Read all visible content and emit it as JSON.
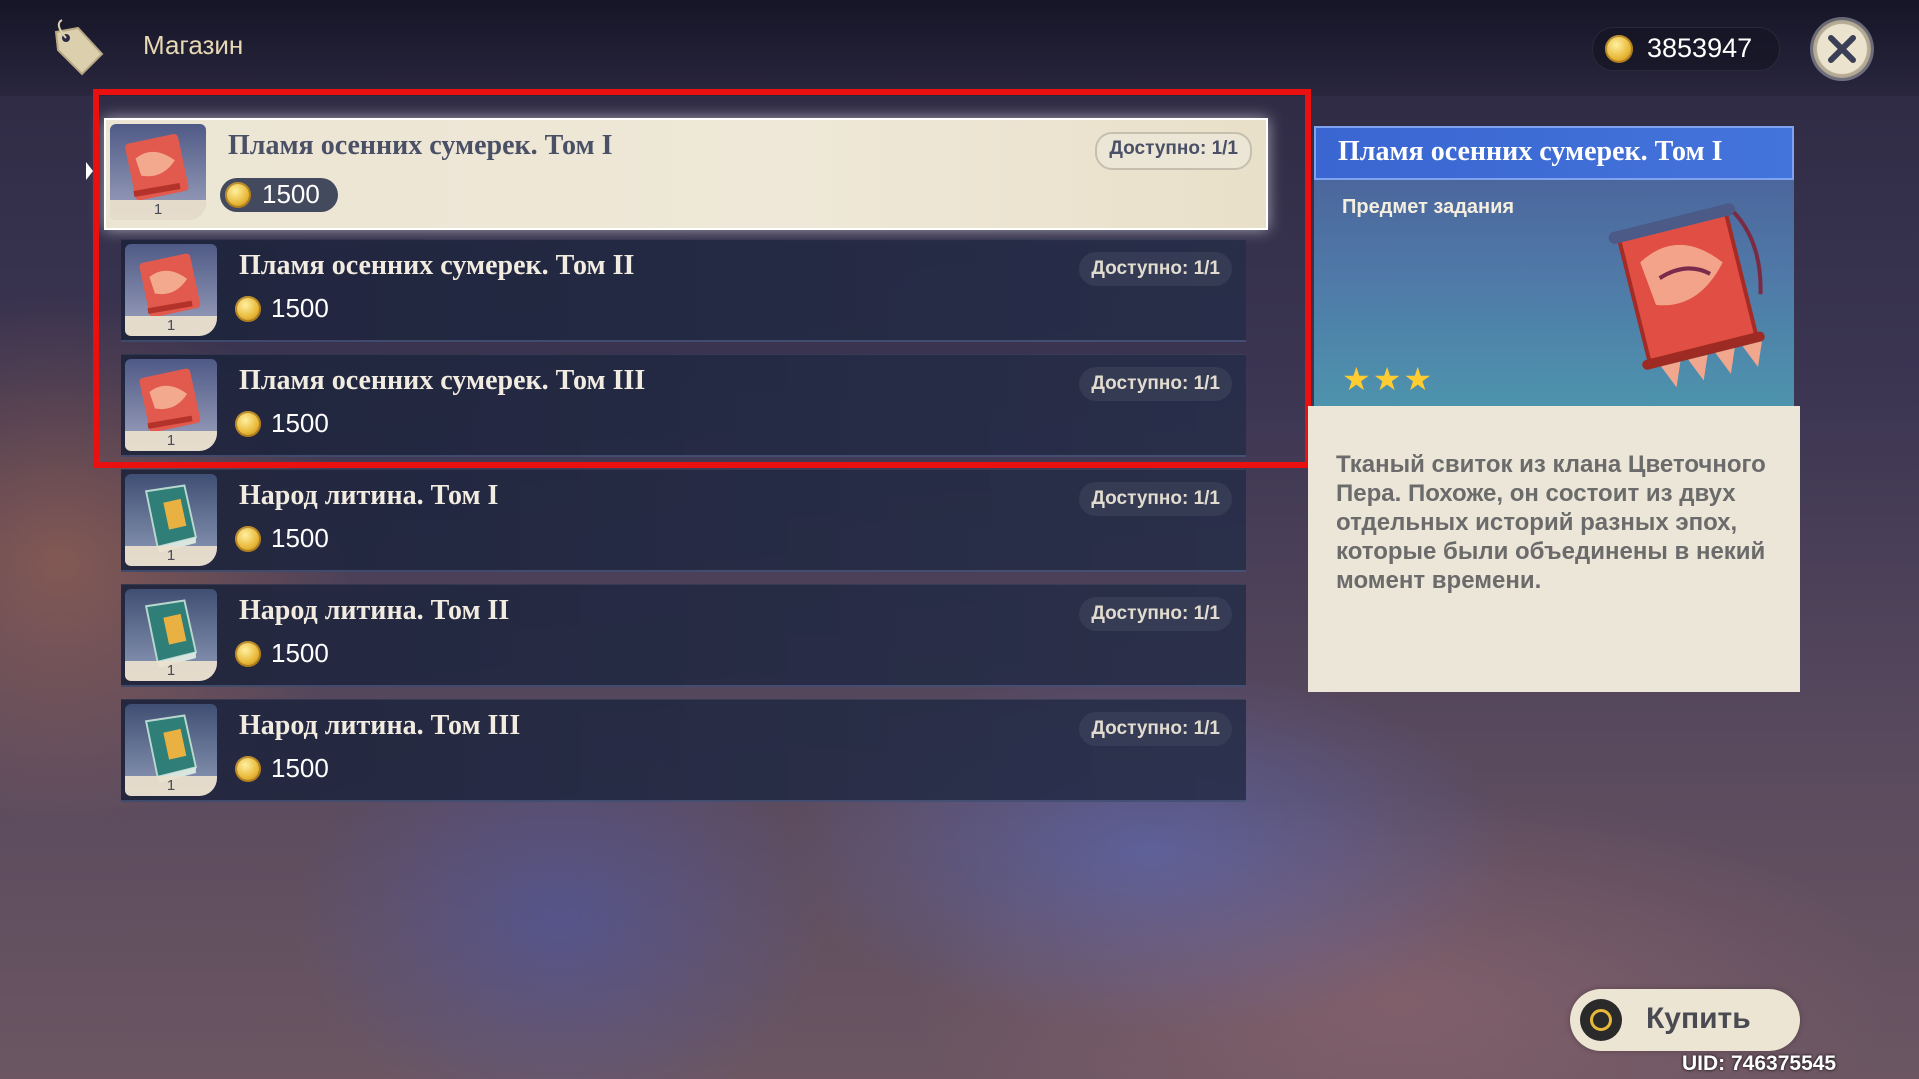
{
  "header": {
    "title": "Магазин",
    "icon": "price-tag-icon",
    "currency_icon": "mora-coin-icon",
    "currency_value": "3853947",
    "close_icon": "close-icon"
  },
  "items": [
    {
      "name": "Пламя осенних сумерек. Том I",
      "price": "1500",
      "availability": "Доступно: 1/1",
      "count": "1",
      "icon": "scroll-icon",
      "selected": true
    },
    {
      "name": "Пламя осенних сумерек. Том II",
      "price": "1500",
      "availability": "Доступно: 1/1",
      "count": "1",
      "icon": "scroll-icon",
      "selected": false
    },
    {
      "name": "Пламя осенних сумерек. Том III",
      "price": "1500",
      "availability": "Доступно: 1/1",
      "count": "1",
      "icon": "scroll-icon",
      "selected": false
    },
    {
      "name": "Народ литина. Том I",
      "price": "1500",
      "availability": "Доступно: 1/1",
      "count": "1",
      "icon": "book-icon",
      "selected": false
    },
    {
      "name": "Народ литина. Том II",
      "price": "1500",
      "availability": "Доступно: 1/1",
      "count": "1",
      "icon": "book-icon",
      "selected": false
    },
    {
      "name": "Народ литина. Том III",
      "price": "1500",
      "availability": "Доступно: 1/1",
      "count": "1",
      "icon": "book-icon",
      "selected": false
    }
  ],
  "detail": {
    "title": "Пламя осенних сумерек. Том I",
    "type": "Предмет задания",
    "rarity_stars": 3,
    "stars_text": "★★★",
    "description": "Тканый свиток из клана Цветочного Пера. Похоже, он состоит из двух отдельных историй разных эпох, которые были объединены в некий момент времени.",
    "art_icon": "scroll-icon"
  },
  "buy_button": {
    "label": "Купить",
    "icon": "confirm-circle-icon"
  },
  "uid": "UID: 746375545",
  "colors": {
    "highlight": "#ea1010",
    "accent": "#3a66d1",
    "gold": "#ffcc32"
  }
}
